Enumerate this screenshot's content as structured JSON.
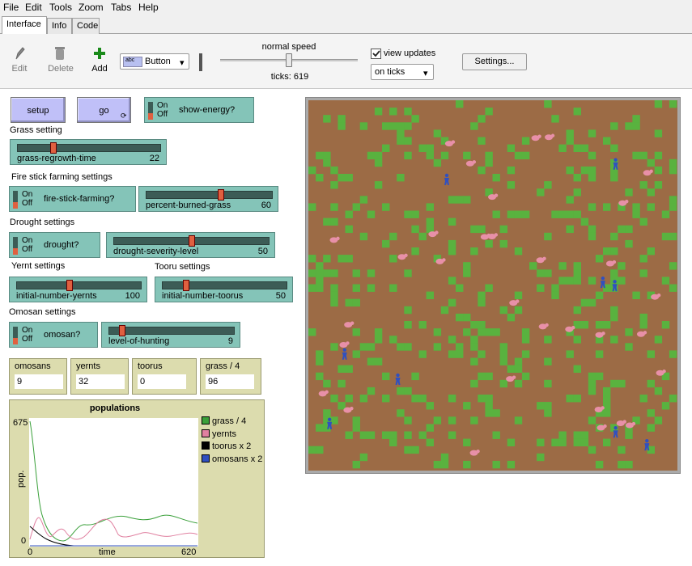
{
  "menu": [
    "File",
    "Edit",
    "Tools",
    "Zoom",
    "Tabs",
    "Help"
  ],
  "tabs": [
    "Interface",
    "Info",
    "Code"
  ],
  "toolbar": {
    "edit_label": "Edit",
    "delete_label": "Delete",
    "add_label": "Add",
    "widget_type": "Button",
    "speed_label": "normal speed",
    "ticks_label": "ticks: 619",
    "view_updates_label": "view updates",
    "view_updates_checked": true,
    "update_mode": "on ticks",
    "settings_label": "Settings..."
  },
  "buttons": {
    "setup": "setup",
    "go": "go"
  },
  "switches": {
    "show_energy": {
      "on": "On",
      "off": "Off",
      "label": "show-energy?"
    },
    "fire_stick": {
      "on": "On",
      "off": "Off",
      "label": "fire-stick-farming?"
    },
    "drought": {
      "on": "On",
      "off": "Off",
      "label": "drought?"
    },
    "omosan": {
      "on": "On",
      "off": "Off",
      "label": "omosan?"
    }
  },
  "sections": {
    "grass": "Grass setting",
    "fire": "Fire stick farming settings",
    "drought": "Drought settings",
    "yernt": "Yernt settings",
    "tooru": "Tooru settings",
    "omosan": "Omosan settings"
  },
  "sliders": {
    "grass_regrowth": {
      "name": "grass-regrowth-time",
      "value": "22",
      "fraction": 0.24
    },
    "percent_burned": {
      "name": "percent-burned-grass",
      "value": "60",
      "fraction": 0.6
    },
    "drought_severity": {
      "name": "drought-severity-level",
      "value": "50",
      "fraction": 0.5
    },
    "initial_yernts": {
      "name": "initial-number-yernts",
      "value": "100",
      "fraction": 0.42
    },
    "initial_toorus": {
      "name": "initial-number-toorus",
      "value": "50",
      "fraction": 0.18
    },
    "hunting": {
      "name": "level-of-hunting",
      "value": "9",
      "fraction": 0.09
    }
  },
  "monitors": [
    {
      "name": "omosans",
      "value": "9"
    },
    {
      "name": "yernts",
      "value": "32"
    },
    {
      "name": "toorus",
      "value": "0"
    },
    {
      "name": "grass / 4",
      "value": "96"
    }
  ],
  "plot": {
    "title": "populations",
    "ylabel": "pop.",
    "xlabel": "time",
    "ymax_label": "675",
    "ymin_label": "0",
    "xmin_label": "0",
    "xmax_label": "620",
    "legend": [
      {
        "name": "grass / 4",
        "color": "#3aa03a"
      },
      {
        "name": "yernts",
        "color": "#e080a0"
      },
      {
        "name": "toorus x 2",
        "color": "#000000"
      },
      {
        "name": "omosans x 2",
        "color": "#3050c0"
      }
    ]
  },
  "colors": {
    "grass": "#59b23f",
    "dirt": "#9c6b45",
    "yernt": "#e890a8",
    "omosan": "#3050c0"
  }
}
